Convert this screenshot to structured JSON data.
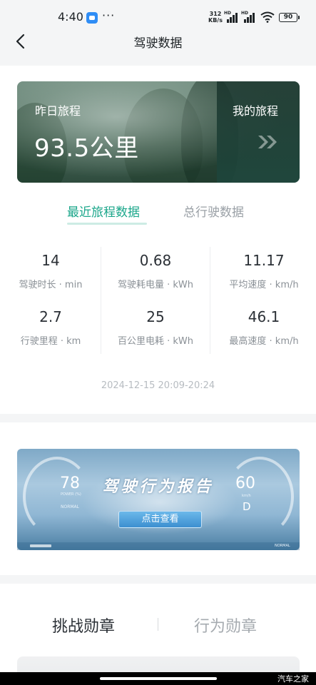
{
  "status_bar": {
    "time": "4:40",
    "more": "···",
    "net_speed_value": "312",
    "net_speed_unit": "KB/s",
    "sim1_label": "HD",
    "sim2_label": "HD",
    "battery": "90"
  },
  "nav": {
    "title": "驾驶数据"
  },
  "banner": {
    "label": "昨日旅程",
    "value": "93.5公里",
    "my_trip_label": "我的旅程"
  },
  "tabs": {
    "recent": "最近旅程数据",
    "total": "总行驶数据",
    "active": "recent"
  },
  "stats": [
    {
      "value": "14",
      "label": "驾驶时长 · min"
    },
    {
      "value": "0.68",
      "label": "驾驶耗电量 · kWh"
    },
    {
      "value": "11.17",
      "label": "平均速度 · km/h"
    },
    {
      "value": "2.7",
      "label": "行驶里程 · km"
    },
    {
      "value": "25",
      "label": "百公里电耗 · kWh"
    },
    {
      "value": "46.1",
      "label": "最高速度 · km/h"
    }
  ],
  "time_range": "2024-12-15 20:09-20:24",
  "report": {
    "title": "驾驶行为报告",
    "power_value": "78",
    "power_label": "POWER (%)",
    "mode_left": "NORMAL",
    "speed_value": "60",
    "speed_unit": "km/h",
    "gear": "D",
    "button_label": "点击查看",
    "mode_right": "NORMAL"
  },
  "medals": {
    "challenge": "挑战勋章",
    "behavior": "行为勋章",
    "active": "challenge"
  },
  "watermark": "汽车之家",
  "colors": {
    "accent": "#1aa68a",
    "inactive_tab": "#9aa0a6",
    "banner_green": "#4f6e5f",
    "report_blue": "#90b7d4"
  }
}
